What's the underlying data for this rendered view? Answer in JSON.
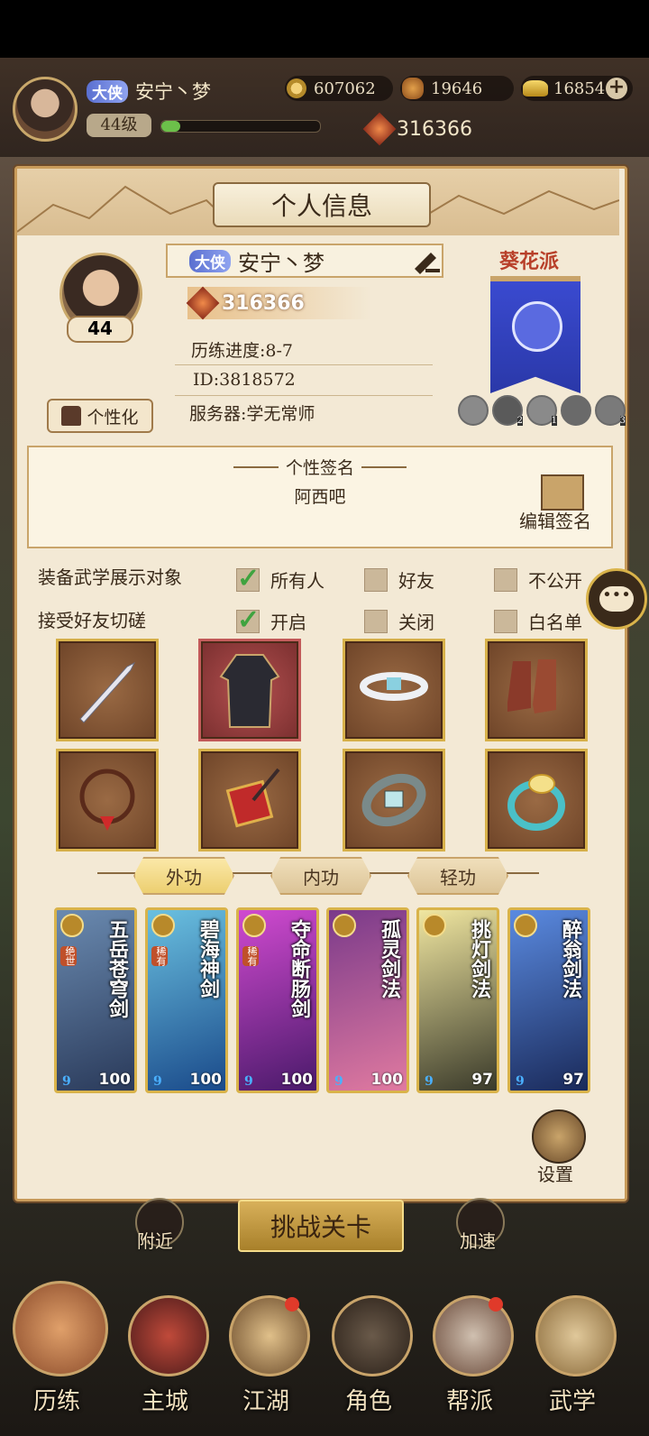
{
  "top": {
    "title_badge": "大侠",
    "player_name": "安宁丶梦",
    "level": "44级",
    "coins": "607062",
    "stamina": "19646",
    "gold": "16854",
    "power": "316366"
  },
  "panel": {
    "title": "个人信息",
    "level": "44",
    "title_badge": "大侠",
    "name": "安宁丶梦",
    "power": "316366",
    "progress": "历练进度:8-7",
    "id": "ID:3818572",
    "server": "服务器:学无常师",
    "customize_label": "个性化",
    "faction": "葵花派",
    "faction_badges": [
      "",
      "2",
      "1",
      "",
      "3"
    ]
  },
  "signature": {
    "header": "个性签名",
    "text": "阿西吧",
    "edit_label": "编辑签名"
  },
  "settings": {
    "show_label": "装备武学展示对象",
    "show_options": [
      "所有人",
      "好友",
      "不公开"
    ],
    "spar_label": "接受好友切磋",
    "spar_options": [
      "开启",
      "关闭",
      "白名单"
    ]
  },
  "equipment": [
    "sword",
    "robe",
    "belt",
    "boots",
    "bracelet",
    "hairpin",
    "armguard",
    "ring"
  ],
  "skill_tabs": [
    "外功",
    "内功",
    "轻功"
  ],
  "skills": [
    {
      "name": "五岳苍穹剑",
      "tag": "绝世",
      "level": "100",
      "color": "#3a5a8a"
    },
    {
      "name": "碧海神剑",
      "tag": "稀有",
      "level": "100",
      "color": "#2f6fa8"
    },
    {
      "name": "夺命断肠剑",
      "tag": "稀有",
      "level": "100",
      "color": "#8a2fa0"
    },
    {
      "name": "孤灵剑法",
      "tag": "",
      "level": "100",
      "color": "#b8405a"
    },
    {
      "name": "挑灯剑法",
      "tag": "",
      "level": "97",
      "color": "#6a6a4a"
    },
    {
      "name": "醉翁剑法",
      "tag": "",
      "level": "97",
      "color": "#2f4f9a"
    }
  ],
  "settings_label": "设置",
  "world": {
    "nearby": "附近",
    "challenge": "挑战关卡",
    "speedup": "加速"
  },
  "nav": [
    "历练",
    "主城",
    "江湖",
    "角色",
    "帮派",
    "武学"
  ]
}
